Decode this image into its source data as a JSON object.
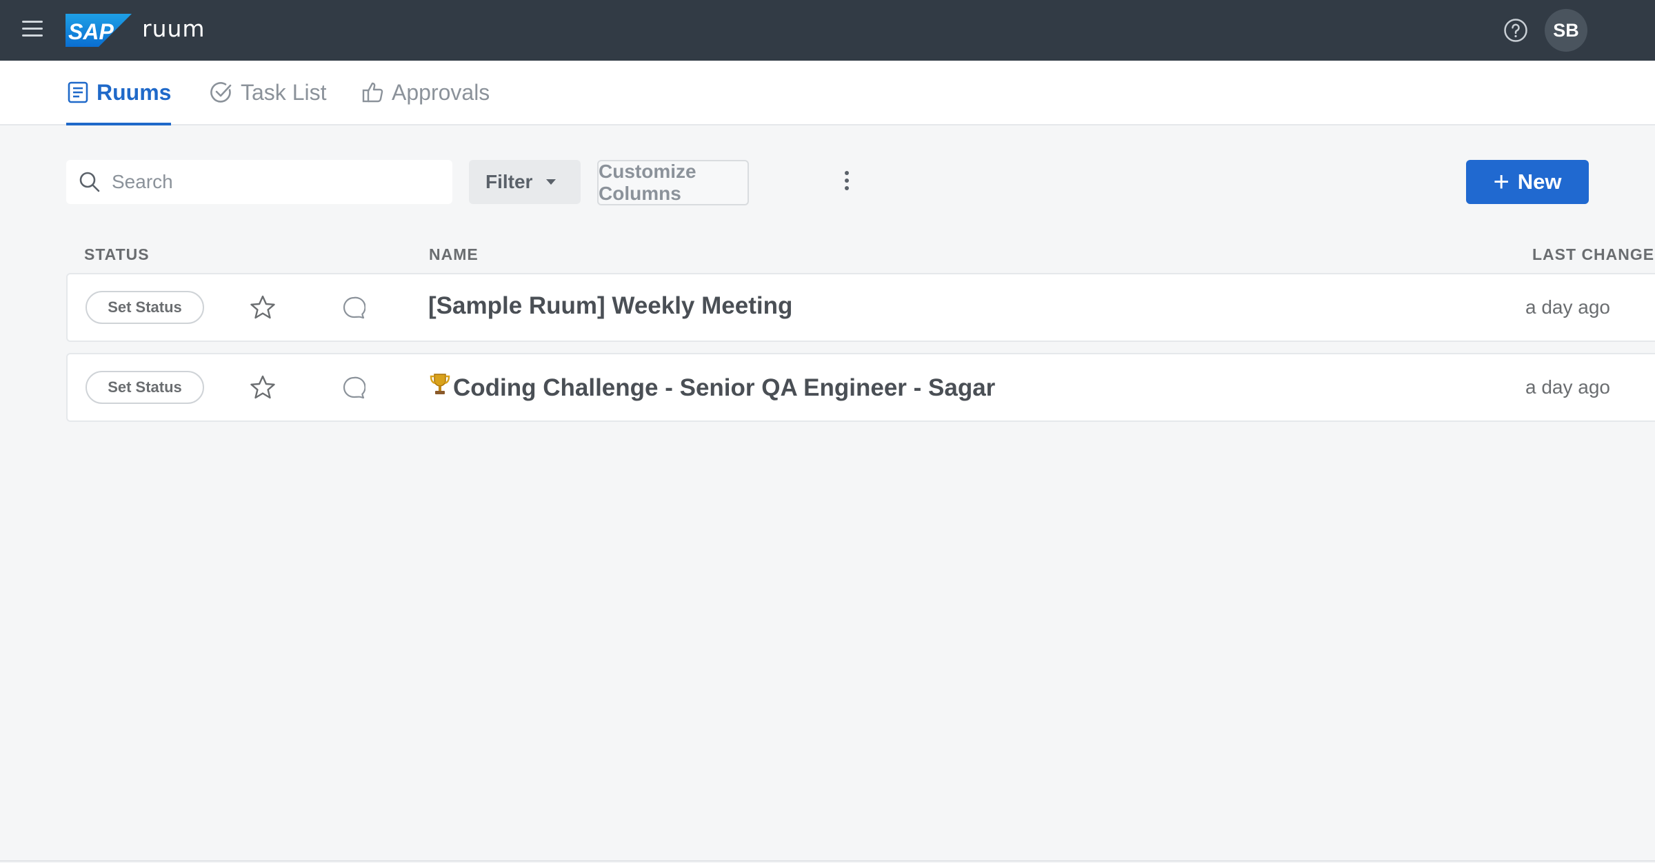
{
  "shell": {
    "logo_text": "SAP",
    "product_name": "ruum",
    "help_icon": "help-circle-icon",
    "avatar_initials": "SB"
  },
  "tabs": [
    {
      "label": "Ruums",
      "icon": "document-icon",
      "active": true
    },
    {
      "label": "Task List",
      "icon": "check-circle-icon",
      "active": false
    },
    {
      "label": "Approvals",
      "icon": "thumbs-up-icon",
      "active": false
    }
  ],
  "toolbar": {
    "search_placeholder": "Search",
    "filter_label": "Filter",
    "customize_label": "Customize Columns",
    "new_label": "New"
  },
  "columns": {
    "status": "STATUS",
    "name": "NAME",
    "last_change": "LAST CHANGE"
  },
  "rows": [
    {
      "status_label": "Set Status",
      "name": "[Sample Ruum] Weekly Meeting",
      "time": "a day ago",
      "emoji": ""
    },
    {
      "status_label": "Set Status",
      "name": "Coding Challenge - Senior QA Engineer - Sagar",
      "time": "a day ago",
      "emoji": "🏆"
    }
  ],
  "colors": {
    "shell_bg": "#323b45",
    "accent": "#1f69c9",
    "new_button": "#2069d0",
    "page_bg": "#f5f6f7"
  }
}
